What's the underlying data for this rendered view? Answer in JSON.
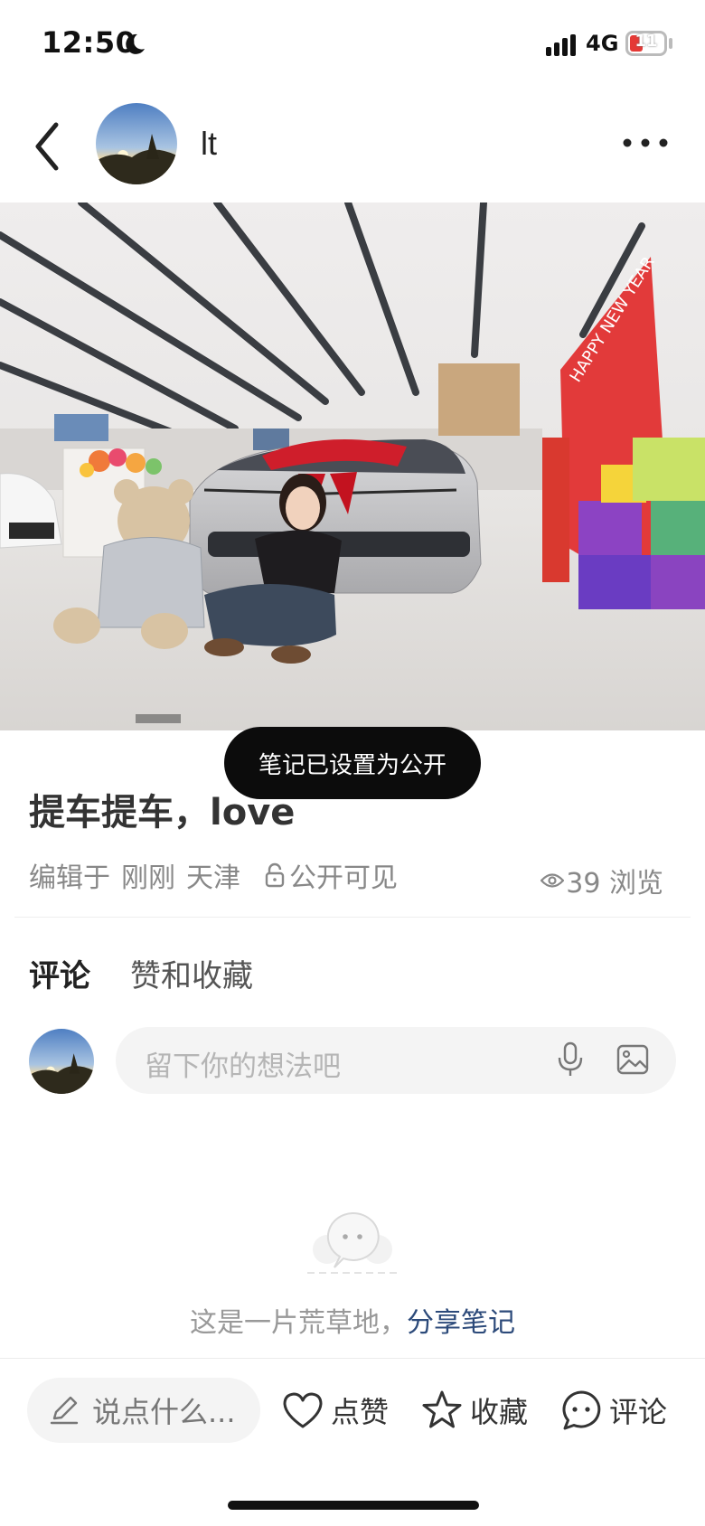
{
  "status_bar": {
    "time": "12:50",
    "network": "4G",
    "battery": "11"
  },
  "header": {
    "username": "lt"
  },
  "toast": {
    "text": "笔记已设置为公开"
  },
  "note": {
    "title": "提车提车，love",
    "edited_label": "编辑于",
    "time": "刚刚",
    "location": "天津",
    "visibility": "公开可见",
    "views": "39 浏览"
  },
  "tabs": [
    {
      "label": "评论"
    },
    {
      "label": "赞和收藏"
    }
  ],
  "comment": {
    "placeholder": "留下你的想法吧"
  },
  "empty_state": {
    "text": "这是一片荒草地，",
    "link": "分享笔记"
  },
  "bottom_bar": {
    "say": "说点什么...",
    "like": "点赞",
    "collect": "收藏",
    "comment": "评论"
  },
  "colors": {
    "toast_bg": "#0c0c0c",
    "link": "#2c4a7a",
    "battery_low": "#e53935"
  }
}
